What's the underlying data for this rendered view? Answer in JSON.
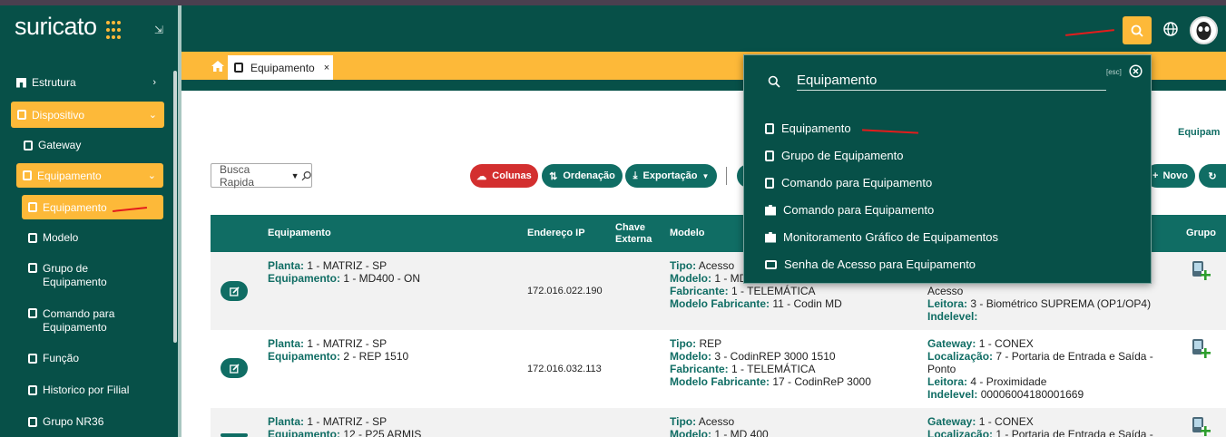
{
  "app": {
    "logo_text": "suricato"
  },
  "sidebar": {
    "items": [
      {
        "label": "Estrutura",
        "icon": "building-icon"
      },
      {
        "label": "Dispositivo",
        "icon": "device-icon"
      },
      {
        "label": "Gateway",
        "icon": "device-icon"
      },
      {
        "label": "Equipamento",
        "icon": "device-icon"
      },
      {
        "label": "Equipamento",
        "icon": "device-icon"
      },
      {
        "label": "Modelo",
        "icon": "device-icon"
      },
      {
        "label": "Grupo de Equipamento",
        "icon": "device-icon"
      },
      {
        "label": "Comando para Equipamento",
        "icon": "device-icon"
      },
      {
        "label": "Função",
        "icon": "device-icon"
      },
      {
        "label": "Historico por Filial",
        "icon": "device-icon"
      },
      {
        "label": "Grupo NR36",
        "icon": "device-icon"
      }
    ]
  },
  "tabs": [
    {
      "label": "Equipamento",
      "close": "×"
    }
  ],
  "page": {
    "right_label": "Equipam"
  },
  "toolbar": {
    "quick_search_placeholder": "Busca Rapida",
    "colunas": "Colunas",
    "ordenacao": "Ordenação",
    "exportacao": "Exportação",
    "novo": "Novo"
  },
  "table": {
    "headers": {
      "equipamento": "Equipamento",
      "ip": "Endereço IP",
      "chave1": "Chave",
      "chave2": "Externa",
      "modelo": "Modelo",
      "grupo": "Grupo"
    },
    "labels": {
      "planta": "Planta:",
      "equipamento": "Equipamento:",
      "tipo": "Tipo:",
      "modelo": "Modelo:",
      "fabricante": "Fabricante:",
      "modelo_fabricante": "Modelo Fabricante:",
      "gateway": "Gateway:",
      "localizacao": "Localização:",
      "leitora": "Leitora:",
      "indelevel": "Indelevel:"
    },
    "rows": [
      {
        "planta": "1 - MATRIZ - SP",
        "equipamento": "1 - MD400 - ON",
        "ip": "172.016.022.190",
        "tipo": "Acesso",
        "modelo": "1 - MD",
        "fabricante": "1 - TELEMÁTICA",
        "modelo_fabricante": "11 - Codin MD",
        "right_line1": "Acesso",
        "leitora": "3 - Biométrico SUPREMA (OP1/OP4)",
        "indelevel": ""
      },
      {
        "planta": "1 - MATRIZ - SP",
        "equipamento": "2 - REP 1510",
        "ip": "172.016.032.113",
        "tipo": "REP",
        "modelo": "3 - CodinREP 3000 1510",
        "fabricante": "1 - TELEMÁTICA",
        "modelo_fabricante": "17 - CodinReP 3000",
        "gateway": "1 - CONEX",
        "localizacao": "7 - Portaria de Entrada e Saída -",
        "localizacao2": "Ponto",
        "leitora": "4 - Proximidade",
        "indelevel": "00006004180001669"
      },
      {
        "planta": "1 - MATRIZ - SP",
        "equipamento": "12 - P25 ARMIS",
        "tipo": "Acesso",
        "modelo": "1 - MD 400",
        "gateway": "1 - CONEX",
        "localizacao": "1 - Portaria de Entrada e Saída -"
      }
    ]
  },
  "search_panel": {
    "query": "Equipamento",
    "esc_hint": "[esc]",
    "results": [
      {
        "label": "Equipamento",
        "icon": "device-icon"
      },
      {
        "label": "Grupo de Equipamento",
        "icon": "device-icon"
      },
      {
        "label": "Comando para Equipamento",
        "icon": "device-icon"
      },
      {
        "label": "Comando para Equipamento",
        "icon": "puzzle-icon"
      },
      {
        "label": "Monitoramento Gráfico de Equipamentos",
        "icon": "puzzle-icon"
      },
      {
        "label": "Senha de Acesso para Equipamento",
        "icon": "id-card-icon"
      }
    ]
  },
  "colors": {
    "primary": "#075048",
    "accent": "#fdb939",
    "danger": "#d32f2f",
    "arrow": "#e31c1c"
  }
}
